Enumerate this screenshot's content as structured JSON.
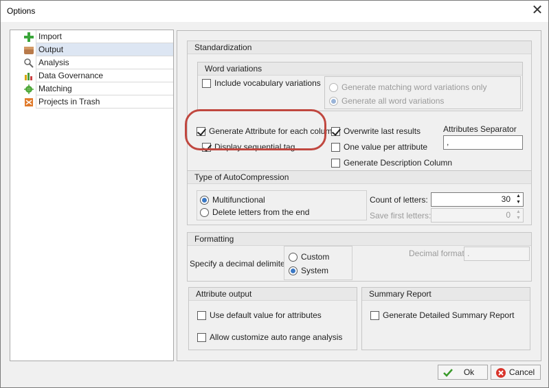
{
  "window": {
    "title": "Options"
  },
  "tree": {
    "items": [
      {
        "label": "Import",
        "icon": "import-icon"
      },
      {
        "label": "Output",
        "icon": "output-icon",
        "selected": true
      },
      {
        "label": "Analysis",
        "icon": "analysis-icon"
      },
      {
        "label": "Data Governance",
        "icon": "data-governance-icon"
      },
      {
        "label": "Matching",
        "icon": "matching-icon"
      },
      {
        "label": "Projects in Trash",
        "icon": "projects-trash-icon"
      }
    ]
  },
  "standardization": {
    "title": "Standardization",
    "word_variations": {
      "title": "Word variations",
      "include_vocabulary": "Include vocabulary variations",
      "generate_matching_only": "Generate matching word variations only",
      "generate_all": "Generate all word variations"
    },
    "generate_attribute": "Generate Attribute for each column",
    "display_sequential_tag": "Display sequential tag",
    "overwrite_last_results": "Overwrite last results",
    "one_value_per_attribute": "One value per attribute",
    "generate_description_column": "Generate Description Column",
    "attributes_separator_label": "Attributes Separator",
    "attributes_separator_value": ","
  },
  "autocompression": {
    "title": "Type of AutoCompression",
    "multifunctional": "Multifunctional",
    "delete_letters": "Delete letters from the end",
    "count_of_letters_label": "Count of letters:",
    "count_of_letters_value": "30",
    "save_first_letters_label": "Save first letters:",
    "save_first_letters_value": "0"
  },
  "formatting": {
    "title": "Formatting",
    "specify_delimiter": "Specify a decimal delimiter:",
    "custom": "Custom",
    "system": "System",
    "decimal_format_label": "Decimal format:",
    "decimal_format_value": "."
  },
  "attribute_output": {
    "title": "Attribute output",
    "use_default": "Use default value for attributes",
    "allow_customize": "Allow customize auto range analysis"
  },
  "summary_report": {
    "title": "Summary Report",
    "generate_detailed": "Generate Detailed Summary Report"
  },
  "buttons": {
    "ok": "Ok",
    "cancel": "Cancel"
  },
  "colors": {
    "highlight": "#c0473f",
    "selection": "#dde6f3",
    "radio_accent": "#3b78c4"
  }
}
